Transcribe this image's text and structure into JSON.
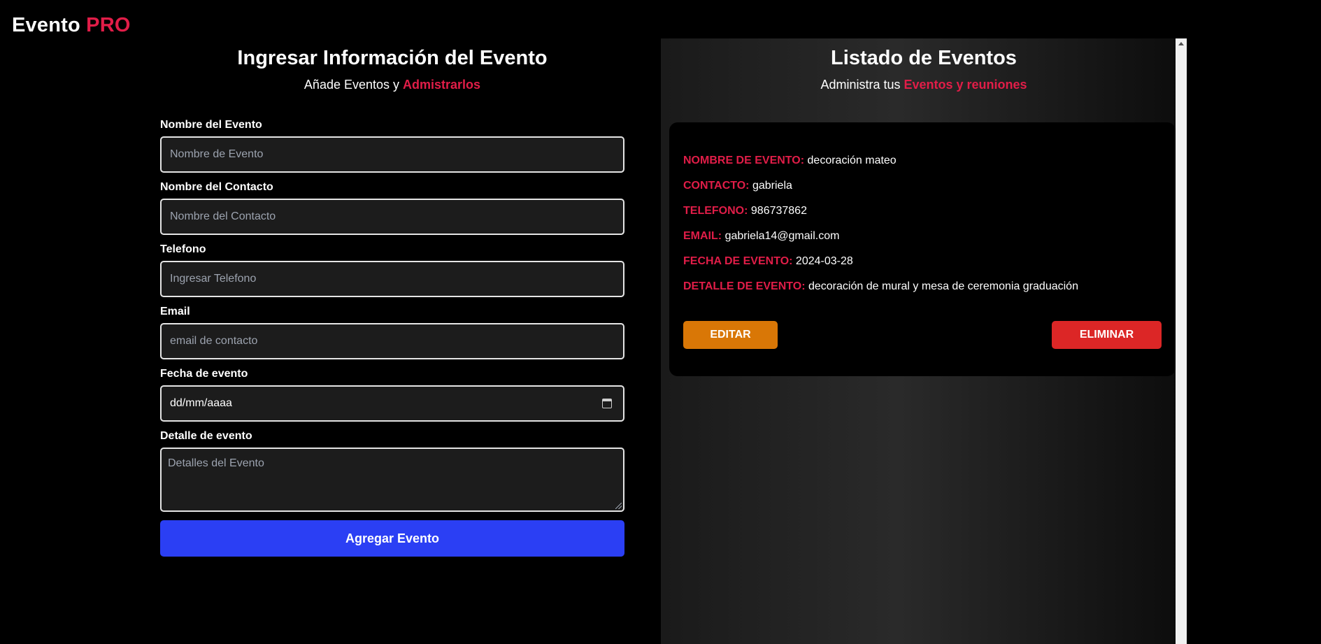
{
  "logo": {
    "main": "Evento",
    "accent": "PRO"
  },
  "form_section": {
    "title": "Ingresar Información del Evento",
    "subtitle_prefix": "Añade Eventos y",
    "subtitle_accent": "Admistrarlos",
    "fields": {
      "event_name": {
        "label": "Nombre del Evento",
        "placeholder": "Nombre de Evento"
      },
      "contact_name": {
        "label": "Nombre del Contacto",
        "placeholder": "Nombre del Contacto"
      },
      "phone": {
        "label": "Telefono",
        "placeholder": "Ingresar Telefono"
      },
      "email": {
        "label": "Email",
        "placeholder": "email de contacto"
      },
      "date": {
        "label": "Fecha de evento",
        "value": "dd/mm/aaaa"
      },
      "details": {
        "label": "Detalle de evento",
        "placeholder": "Detalles del Evento"
      }
    },
    "submit_label": "Agregar Evento"
  },
  "list_section": {
    "title": "Listado de Eventos",
    "subtitle_prefix": "Administra tus",
    "subtitle_accent": "Eventos y reuniones",
    "events": [
      {
        "name_key": "NOMBRE DE EVENTO:",
        "name": "decoración mateo",
        "contact_key": "CONTACTO:",
        "contact": "gabriela",
        "phone_key": "TELEFONO:",
        "phone": "986737862",
        "email_key": "EMAIL:",
        "email": "gabriela14@gmail.com",
        "date_key": "FECHA DE EVENTO:",
        "date": "2024-03-28",
        "details_key": "DETALLE DE EVENTO:",
        "details": "decoración de mural y mesa de ceremonia graduación",
        "edit_label": "EDITAR",
        "delete_label": "ELIMINAR"
      }
    ]
  },
  "colors": {
    "accent": "#e11d48",
    "primary_button": "#2b3ff4",
    "edit_button": "#d97706",
    "delete_button": "#dc2626",
    "background": "#000000"
  }
}
